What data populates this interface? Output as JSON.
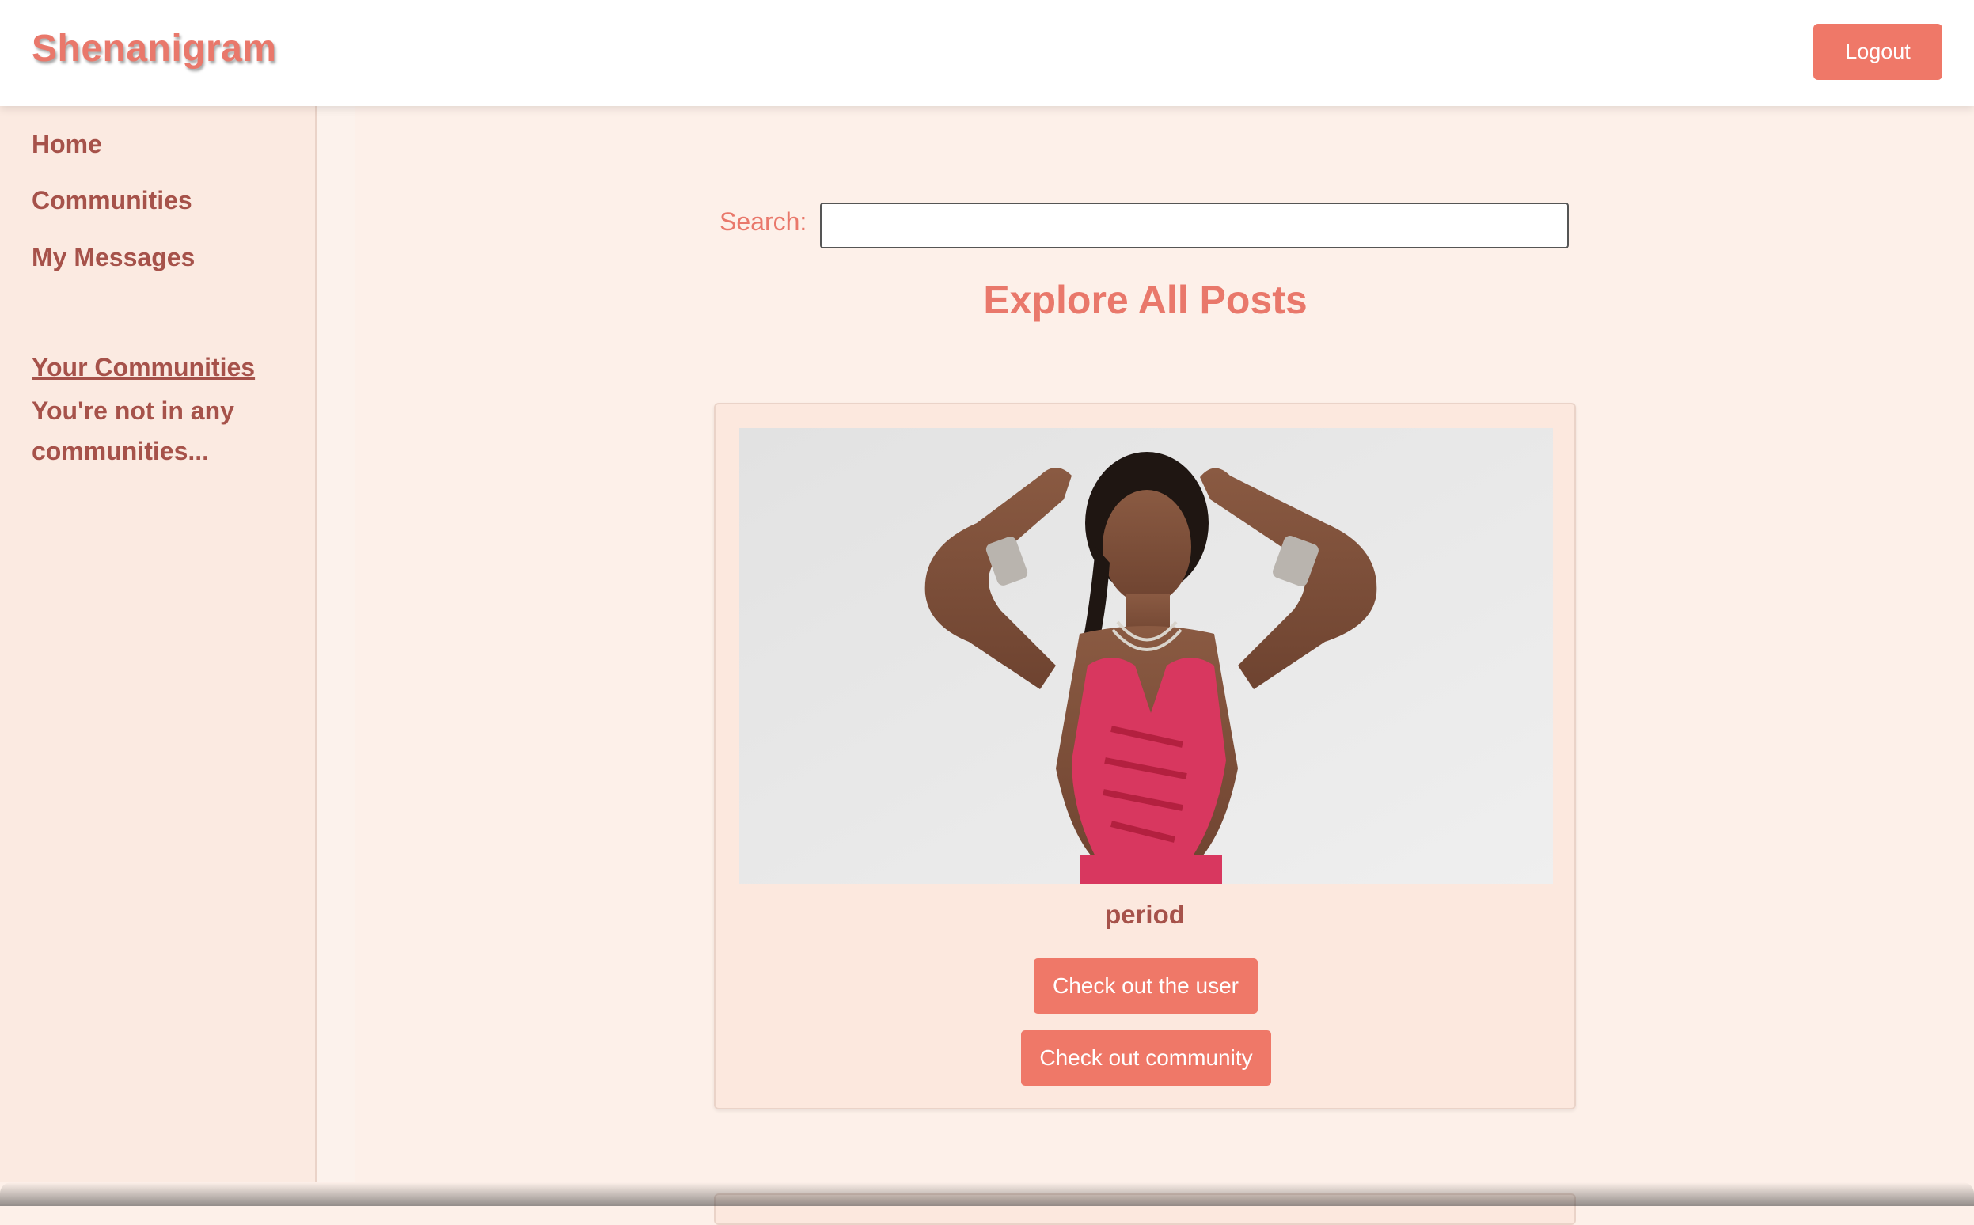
{
  "header": {
    "brand": "Shenanigram",
    "logout_label": "Logout"
  },
  "sidebar": {
    "items": [
      {
        "label": "Home"
      },
      {
        "label": "Communities"
      },
      {
        "label": "My Messages"
      }
    ],
    "your_communities_label": "Your Communities",
    "empty_communities_text": "You're not in any communities..."
  },
  "main": {
    "search_label": "Search:",
    "search_value": "",
    "title": "Explore All Posts",
    "posts": [
      {
        "image": "photo of woman in pink cut-out top with braids, hands on head",
        "caption": "period",
        "user_button": "Check out the user",
        "community_button": "Check out community"
      }
    ]
  },
  "colors": {
    "accent": "#ef7868",
    "brand": "#e9786b",
    "sidebar_text": "#a6524a",
    "background": "#fdf0e9",
    "card_background": "#fce8de"
  }
}
